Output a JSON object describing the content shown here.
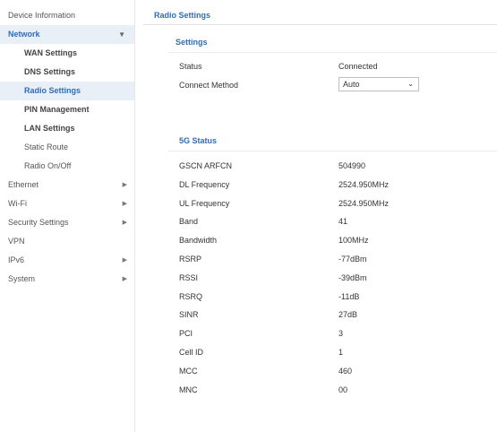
{
  "sidebar": {
    "device_info": "Device Information",
    "network": "Network",
    "network_sub": {
      "wan": "WAN Settings",
      "dns": "DNS Settings",
      "radio": "Radio Settings",
      "pin": "PIN Management",
      "lan": "LAN Settings",
      "static_route": "Static Route",
      "radio_onoff": "Radio On/Off"
    },
    "ethernet": "Ethernet",
    "wifi": "Wi-Fi",
    "security": "Security Settings",
    "vpn": "VPN",
    "ipv6": "IPv6",
    "system": "System"
  },
  "main": {
    "page_title": "Radio Settings",
    "settings_title": "Settings",
    "status_label": "Status",
    "status_value": "Connected",
    "connect_method_label": "Connect Method",
    "connect_method_value": "Auto",
    "status5g_title": "5G Status",
    "rows": [
      {
        "label": "GSCN ARFCN",
        "value": "504990"
      },
      {
        "label": "DL Frequency",
        "value": "2524.950MHz"
      },
      {
        "label": "UL Frequency",
        "value": "2524.950MHz"
      },
      {
        "label": "Band",
        "value": "41"
      },
      {
        "label": "Bandwidth",
        "value": "100MHz"
      },
      {
        "label": "RSRP",
        "value": "-77dBm"
      },
      {
        "label": "RSSI",
        "value": "-39dBm"
      },
      {
        "label": "RSRQ",
        "value": "-11dB"
      },
      {
        "label": "SINR",
        "value": "27dB"
      },
      {
        "label": "PCI",
        "value": "3"
      },
      {
        "label": "Cell ID",
        "value": "1"
      },
      {
        "label": "MCC",
        "value": "460"
      },
      {
        "label": "MNC",
        "value": "00"
      }
    ]
  },
  "colors": {
    "accent": "#2f6db5",
    "active_bg": "#e9eff7"
  }
}
